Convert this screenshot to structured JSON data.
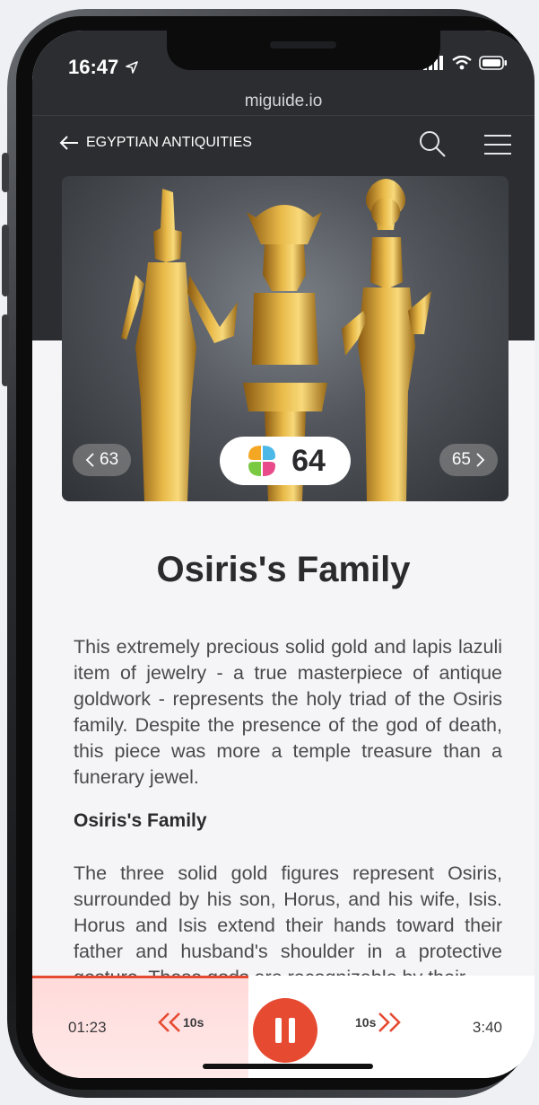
{
  "status_bar": {
    "time": "16:47",
    "location_icon": "location-arrow-icon",
    "signal_icon": "signal-bars-icon",
    "wifi_icon": "wifi-icon",
    "battery_icon": "battery-icon"
  },
  "browser": {
    "url": "miguide.io"
  },
  "header": {
    "back_icon": "arrow-left-icon",
    "title": "EGYPTIAN ANTIQUITIES",
    "search_icon": "search-icon",
    "menu_icon": "hamburger-menu-icon"
  },
  "hero": {
    "prev_label": "63",
    "current_number": "64",
    "next_label": "65",
    "logo_icon": "miguide-clover-icon"
  },
  "article": {
    "title": "Osiris's Family",
    "paragraph1": "This extremely precious solid gold and lapis lazuli item of jewelry - a true masterpiece of antique goldwork - represents the holy triad of the Osiris family. Despite the presence of the god of death, this piece was more a temple treasure than a funerary jewel.",
    "subheading": "Osiris's Family",
    "paragraph2": "The three solid gold figures represent Osiris, surrounded by his son, Horus, and his wife, Isis. Horus and Isis extend their hands toward their father and husband's shoulder in a protective gesture. These gods are recognizable by their"
  },
  "player": {
    "current_time": "01:23",
    "total_time": "3:40",
    "rewind_label": "10s",
    "forward_label": "10s",
    "progress_fraction": 0.43,
    "accent_color": "#e64b32"
  }
}
